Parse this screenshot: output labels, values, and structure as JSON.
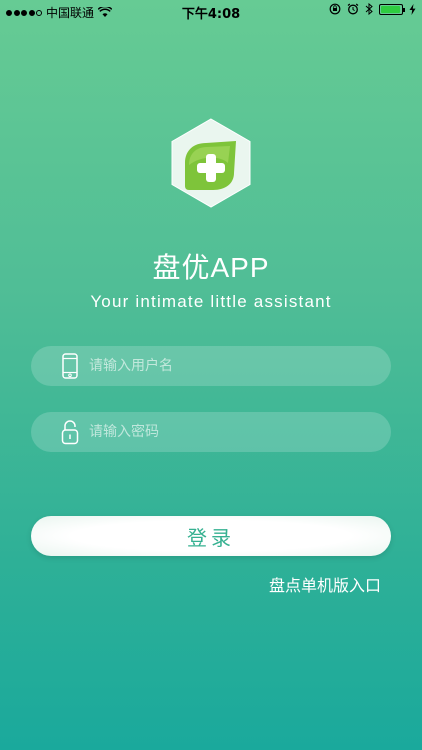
{
  "status_bar": {
    "carrier": "中国联通",
    "time": "下午4:08",
    "battery_level": 0.95,
    "icons": [
      "signal-icon",
      "wifi-icon",
      "lock-rotation-icon",
      "alarm-icon",
      "bluetooth-icon",
      "battery-icon",
      "charging-icon"
    ]
  },
  "logo": {
    "icon": "plus-leaf-icon",
    "colors": {
      "hexagon": "#eaf6ef",
      "leaf": "#7ec43a"
    }
  },
  "app": {
    "title": "盘优APP",
    "subtitle": "Your intimate little assistant"
  },
  "form": {
    "username": {
      "placeholder": "请输入用户名",
      "value": "",
      "icon": "phone-icon"
    },
    "password": {
      "placeholder": "请输入密码",
      "value": "",
      "icon": "lock-icon"
    },
    "login_label": "登录"
  },
  "links": {
    "standalone_entry": "盘点单机版入口"
  },
  "colors": {
    "gradient_top": "#66cb94",
    "gradient_bottom": "#1aa99c",
    "button_text": "#36b191"
  }
}
